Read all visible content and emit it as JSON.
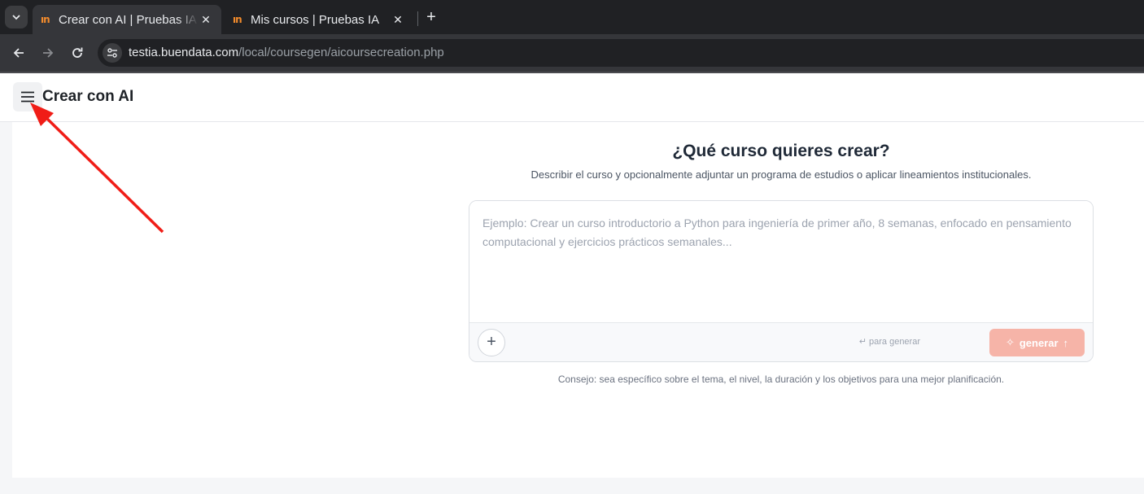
{
  "browser": {
    "tabs": [
      {
        "title": "Crear con AI | Pruebas IA",
        "favicon_text": "ın",
        "active": true
      },
      {
        "title": "Mis cursos | Pruebas IA",
        "favicon_text": "ın",
        "active": false
      }
    ],
    "close_glyph": "✕",
    "new_tab_glyph": "+",
    "url_host": "testia.buendata.com",
    "url_path": "/local/coursegen/aicoursecreation.php"
  },
  "header": {
    "title": "Crear con AI"
  },
  "main": {
    "heading": "¿Qué curso quieres crear?",
    "subheading": "Describir el curso y opcionalmente adjuntar un programa de estudios o aplicar lineamientos institucionales.",
    "prompt_placeholder": "Ejemplo: Crear un curso introductorio a Python para ingeniería de primer año, 8 semanas, enfocado en pensamiento computacional y ejercicios prácticos semanales...",
    "attach_label": "+",
    "hint": "↵ para generar",
    "generate_label": "generar",
    "generate_icon": "✧",
    "generate_arrow": "↑",
    "tip": "Consejo: sea específico sobre el tema, el nivel, la duración y los objetivos para una mejor planificación."
  },
  "colors": {
    "annotation_arrow": "#f01d17",
    "generate_button": "#f6b4a8"
  }
}
